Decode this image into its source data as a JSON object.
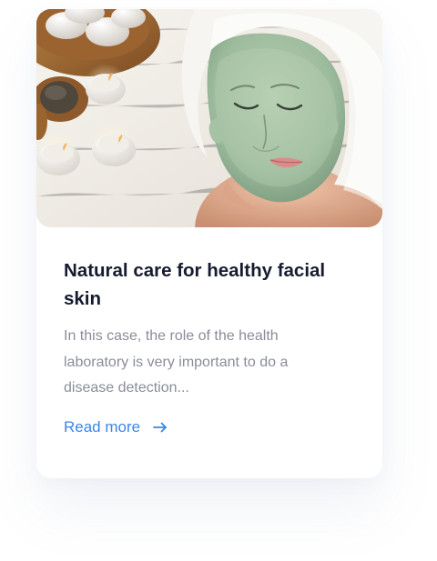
{
  "card": {
    "image_alt": "Woman with green facial mask lying with towel on her head beside candles and spa stones",
    "title": "Natural care for healthy facial skin",
    "excerpt": "In this case, the role of the health laboratory is very important to do a disease detection...",
    "read_more_label": "Read more",
    "read_more_icon": "arrow-right-icon"
  },
  "colors": {
    "title": "#161b2f",
    "excerpt": "#8a8d99",
    "link": "#3b86e8",
    "mask": "#9fbea1",
    "towel": "#f3f2ef"
  }
}
